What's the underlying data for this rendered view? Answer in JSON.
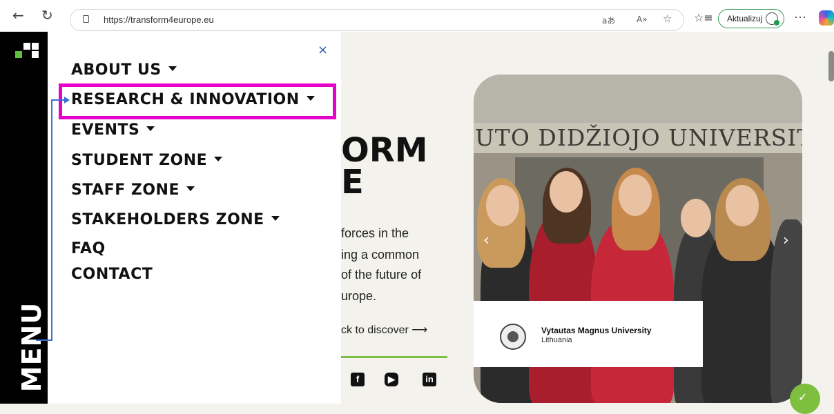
{
  "browser": {
    "url": "https://transform4europe.eu",
    "update_label": "Aktualizuj",
    "more_label": "···",
    "icons": {
      "back": "back-arrow-icon",
      "refresh": "refresh-icon",
      "lock": "lock-icon",
      "read_aloud": "read-aloud-icon",
      "translate": "translate-icon",
      "favorite": "star-icon",
      "favorites": "favorites-list-icon"
    }
  },
  "menu": {
    "vertical_label": "MENU",
    "close": "×",
    "items": [
      {
        "label": "ABOUT US",
        "has_caret": true
      },
      {
        "label": "RESEARCH & INNOVATION",
        "has_caret": true
      },
      {
        "label": "EVENTS",
        "has_caret": true
      },
      {
        "label": "STUDENT ZONE",
        "has_caret": true
      },
      {
        "label": "STAFF ZONE",
        "has_caret": true
      },
      {
        "label": "STAKEHOLDERS ZONE",
        "has_caret": true
      },
      {
        "label": "FAQ",
        "has_caret": false
      },
      {
        "label": "CONTACT",
        "has_caret": false
      }
    ],
    "highlighted_item": "RESEARCH & INNOVATION",
    "highlight_color": "#e600c8",
    "annotation_color": "#3d6fd0"
  },
  "hero": {
    "title_line1": "ORM",
    "title_line2": "E",
    "text_lines": [
      "forces in the",
      "ing a common",
      "of the future of",
      "urope."
    ],
    "cta": "ck to discover ⟶",
    "accent_line_color": "#7cbf4a",
    "social": [
      "facebook-icon",
      "youtube-icon",
      "linkedin-icon"
    ]
  },
  "slider": {
    "sign_text": "UTO DIDŽIOJO UNIVERSIT",
    "prev": "‹",
    "next": "›",
    "caption_title": "Vytautas Magnus University",
    "caption_subtitle": "Lithuania"
  }
}
